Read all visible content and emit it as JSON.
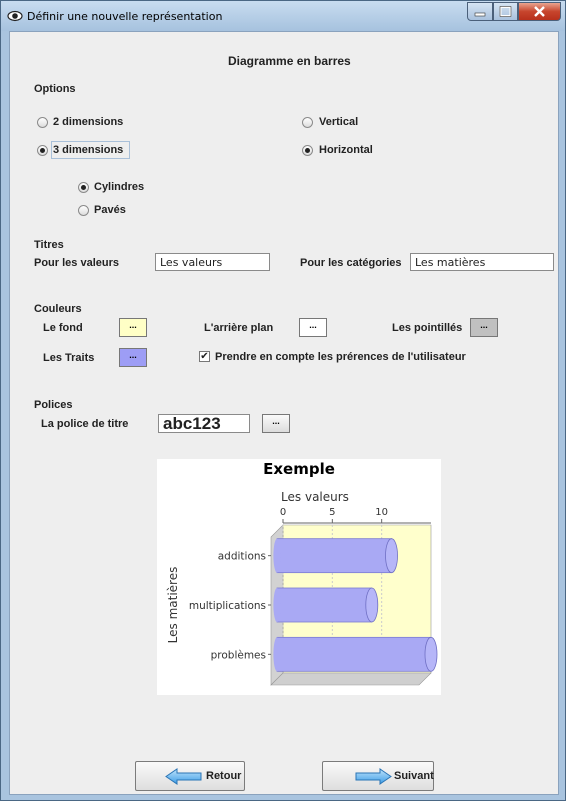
{
  "window": {
    "title": "Définir une nouvelle représentation"
  },
  "dialog": {
    "heading": "Diagramme en barres"
  },
  "options": {
    "label": "Options",
    "dim2": "2 dimensions",
    "dim3": "3 dimensions",
    "vertical": "Vertical",
    "horizontal": "Horizontal",
    "cylindres": "Cylindres",
    "paves": "Pavés",
    "selected_dimension": "3 dimensions",
    "selected_orientation": "Horizontal",
    "selected_shape": "Cylindres"
  },
  "titres": {
    "label": "Titres",
    "valeurs_label": "Pour les valeurs",
    "valeurs_value": "Les valeurs",
    "categories_label": "Pour les catégories",
    "categories_value": "Les matières"
  },
  "couleurs": {
    "label": "Couleurs",
    "fond_label": "Le fond",
    "arriere_label": "L'arrière plan",
    "pointilles_label": "Les pointillés",
    "traits_label": "Les Traits",
    "pref_label": "Prendre en compte les prérences de  l'utilisateur",
    "pref_checked": true,
    "button_label": "...",
    "fond_color": "#ffffc6",
    "arriere_color": "#ffffff",
    "pointilles_color": "#c0c0c0",
    "traits_color": "#9d9df5"
  },
  "polices": {
    "label": "Polices",
    "titre_label": "La police de titre",
    "sample": "abc123",
    "button_label": "..."
  },
  "chart_data": {
    "type": "bar",
    "orientation": "horizontal",
    "style": "3d-cylinder",
    "title": "Exemple",
    "xlabel": "Les valeurs",
    "ylabel": "Les matières",
    "categories": [
      "additions",
      "multiplications",
      "problèmes"
    ],
    "values": [
      11,
      9,
      15
    ],
    "ticks": [
      0,
      5,
      10
    ],
    "xlim": [
      0,
      15
    ],
    "grid": true,
    "bar_color": "#a9a9f4",
    "plot_background": "#ffffcc"
  },
  "nav": {
    "back_label": "Retour",
    "next_label": "Suivant"
  }
}
